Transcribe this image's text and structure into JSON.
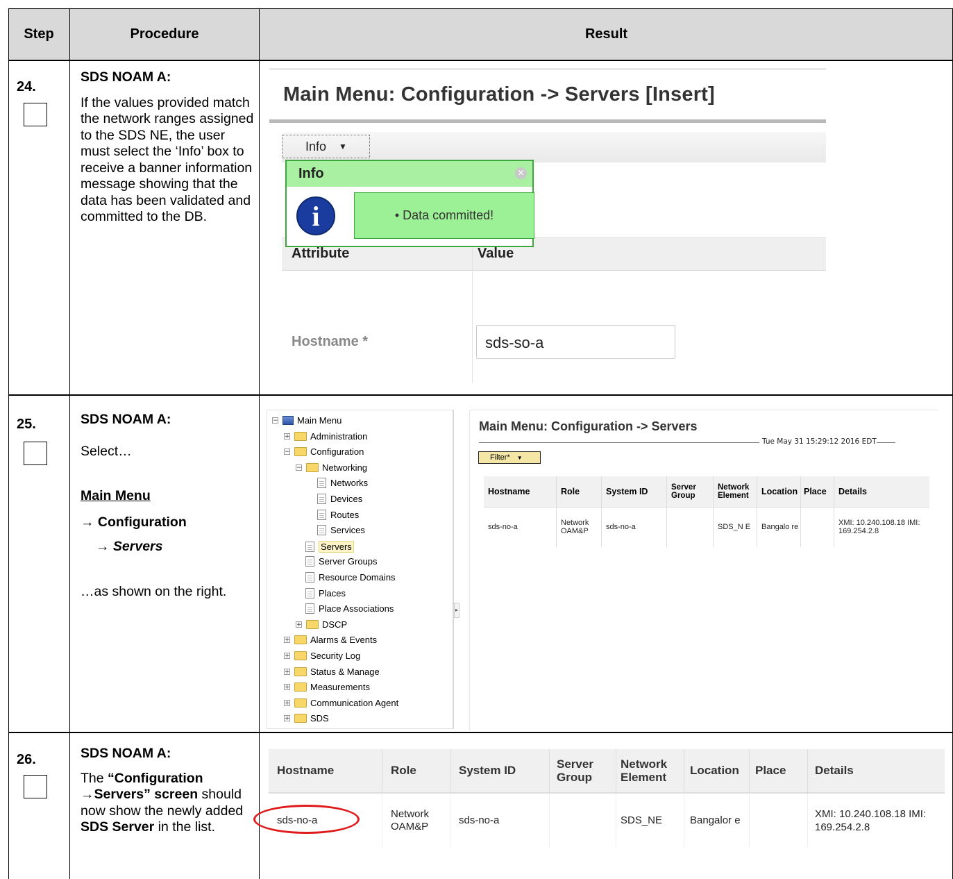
{
  "table_header": {
    "step": "Step",
    "procedure": "Procedure",
    "result": "Result"
  },
  "steps": [
    {
      "number": "24.",
      "title": "SDS NOAM A:",
      "text": "If the values provided match the network ranges assigned to the SDS NE, the user must select the ‘Info’ box to receive a banner information message showing that the data has been validated and committed to the DB."
    },
    {
      "number": "25.",
      "title": "SDS NOAM A:",
      "select": "Select…",
      "menu_path": [
        "Main Menu",
        "→ Configuration",
        "→ Servers"
      ],
      "after": "…as shown on the right."
    },
    {
      "number": "26.",
      "title": "SDS NOAM A:",
      "parts": [
        "The ",
        "“Configuration →Servers” screen",
        " should now show the newly added ",
        "SDS Server",
        " in the list."
      ]
    }
  ],
  "step24_screen": {
    "title": "Main Menu: Configuration -> Servers [Insert]",
    "info_button": "Info",
    "info_popup_title": "Info",
    "message": "• Data committed!",
    "columns": [
      "Attribute",
      "Value"
    ],
    "hostname_label": "Hostname *",
    "hostname_value": "sds-so-a"
  },
  "step25_screen": {
    "tree": [
      {
        "label": "Main Menu",
        "kind": "root"
      },
      {
        "label": "Administration",
        "kind": "folder"
      },
      {
        "label": "Configuration",
        "kind": "folder-open"
      },
      {
        "label": "Networking",
        "kind": "folder-open"
      },
      {
        "label": "Networks",
        "kind": "page"
      },
      {
        "label": "Devices",
        "kind": "page"
      },
      {
        "label": "Routes",
        "kind": "page"
      },
      {
        "label": "Services",
        "kind": "page"
      },
      {
        "label": "Servers",
        "kind": "page",
        "selected": true
      },
      {
        "label": "Server Groups",
        "kind": "page"
      },
      {
        "label": "Resource Domains",
        "kind": "page"
      },
      {
        "label": "Places",
        "kind": "page"
      },
      {
        "label": "Place Associations",
        "kind": "page"
      },
      {
        "label": "DSCP",
        "kind": "folder"
      },
      {
        "label": "Alarms & Events",
        "kind": "folder"
      },
      {
        "label": "Security Log",
        "kind": "folder"
      },
      {
        "label": "Status & Manage",
        "kind": "folder"
      },
      {
        "label": "Measurements",
        "kind": "folder"
      },
      {
        "label": "Communication Agent",
        "kind": "folder"
      },
      {
        "label": "SDS",
        "kind": "folder"
      }
    ],
    "title": "Main Menu: Configuration -> Servers",
    "timestamp": "Tue May 31 15:29:12 2016 EDT",
    "filter": "Filter*",
    "columns": [
      "Hostname",
      "Role",
      "System ID",
      "Server Group",
      "Network Element",
      "Location",
      "Place",
      "Details"
    ],
    "row": [
      "sds-no-a",
      "Network OAM&P",
      "sds-no-a",
      "",
      "SDS_N E",
      "Bangalo re",
      "",
      "XMI: 10.240.108.18 IMI: 169.254.2.8"
    ]
  },
  "step26_screen": {
    "columns": [
      "Hostname",
      "Role",
      "System ID",
      "Server Group",
      "Network Element",
      "Location",
      "Place",
      "Details"
    ],
    "row": [
      "sds-no-a",
      "Network OAM&P",
      "sds-no-a",
      "",
      "SDS_NE",
      "Bangalor e",
      "",
      "XMI: 10.240.108.18 IMI: 169.254.2.8"
    ]
  }
}
